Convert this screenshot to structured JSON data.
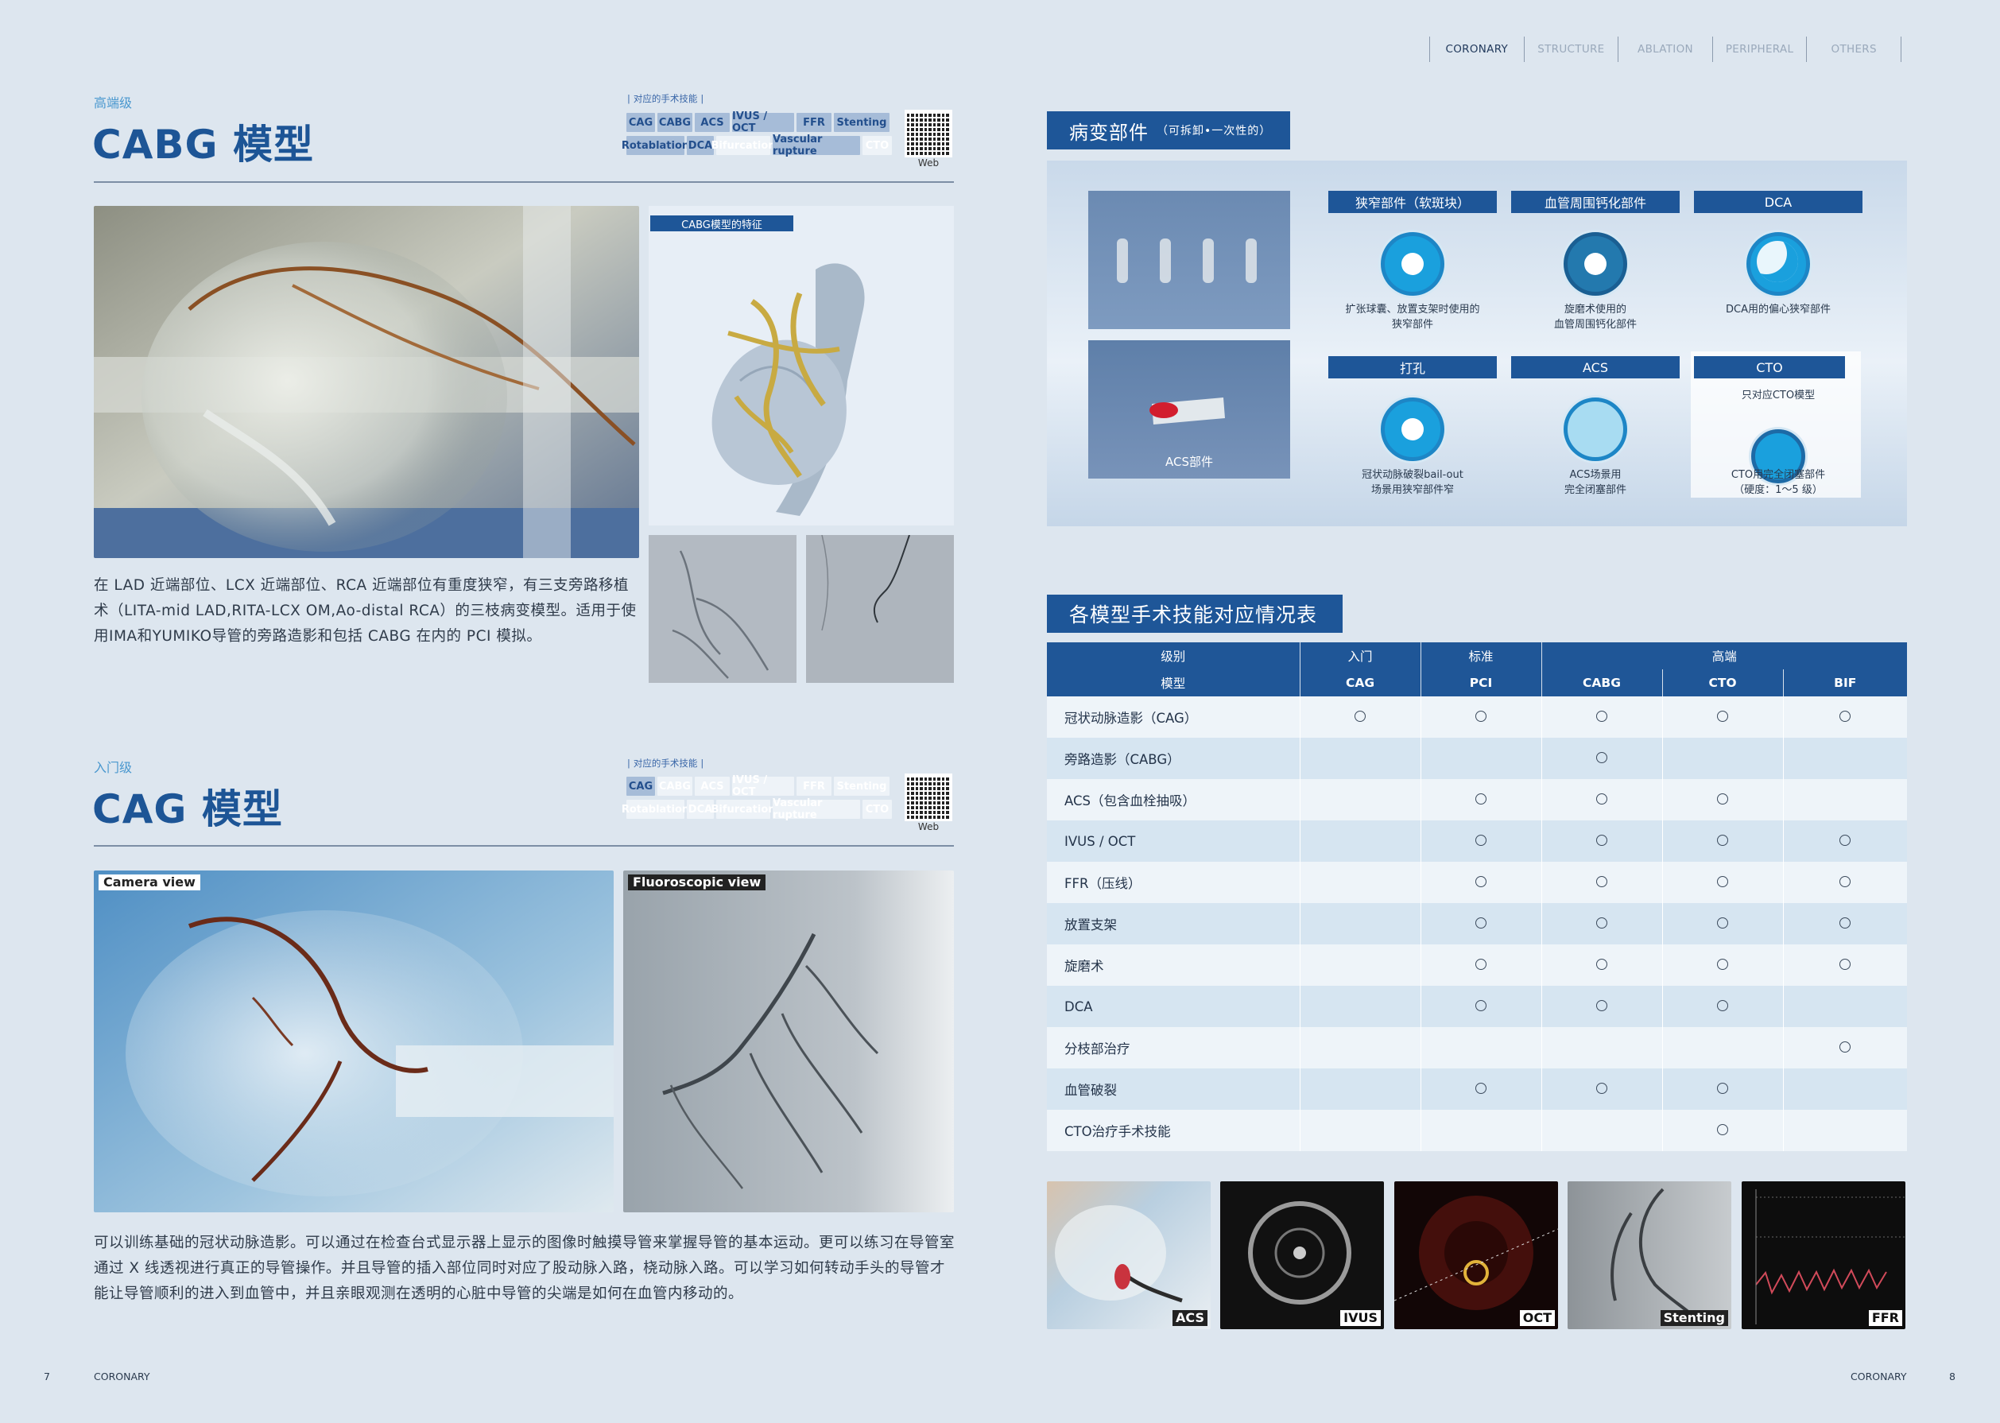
{
  "nav": {
    "tabs": [
      "CORONARY",
      "STRUCTURE",
      "ABLATION",
      "PERIPHERAL",
      "OTHERS"
    ]
  },
  "cabg": {
    "level": "高端级",
    "title": "CABG 模型",
    "skills_label": "对应的手术技能",
    "tags": [
      {
        "label": "CAG",
        "on": true
      },
      {
        "label": "CABG",
        "on": true
      },
      {
        "label": "ACS",
        "on": true
      },
      {
        "label": "IVUS / OCT",
        "on": true
      },
      {
        "label": "FFR",
        "on": true
      },
      {
        "label": "Stenting",
        "on": true
      },
      {
        "label": "Rotablation",
        "on": true
      },
      {
        "label": "DCA",
        "on": true
      },
      {
        "label": "Bifurcation",
        "on": false
      },
      {
        "label": "Vascular rupture",
        "on": true
      },
      {
        "label": "CTO",
        "on": false
      }
    ],
    "qr_label": "Web",
    "feature_label": "CABG模型的特征",
    "description": "在 LAD 近端部位、LCX 近端部位、RCA 近端部位有重度狭窄，有三支旁路移植术（LITA-mid LAD,RITA-LCX OM,Ao-distal RCA）的三枝病变模型。适用于使用IMA和YUMIKO导管的旁路造影和包括 CABG 在内的 PCI 模拟。"
  },
  "cag": {
    "level": "入门级",
    "title": "CAG 模型",
    "skills_label": "对应的手术技能",
    "tags": [
      {
        "label": "CAG",
        "on": true
      },
      {
        "label": "CABG",
        "on": false
      },
      {
        "label": "ACS",
        "on": false
      },
      {
        "label": "IVUS / OCT",
        "on": false
      },
      {
        "label": "FFR",
        "on": false
      },
      {
        "label": "Stenting",
        "on": false
      },
      {
        "label": "Rotablation",
        "on": false
      },
      {
        "label": "DCA",
        "on": false
      },
      {
        "label": "Bifurcation",
        "on": false
      },
      {
        "label": "Vascular rupture",
        "on": false
      },
      {
        "label": "CTO",
        "on": false
      }
    ],
    "qr_label": "Web",
    "camera_label": "Camera view",
    "fluoro_label": "Fluoroscopic view",
    "description": "可以训练基础的冠状动脉造影。可以通过在检查台式显示器上显示的图像时触摸导管来掌握导管的基本运动。更可以练习在导管室通过 X 线透视进行真正的导管操作。并且导管的插入部位同时对应了股动脉入路，桡动脉入路。可以学习如何转动手头的导管才能让导管顺利的进入到血管中，并且亲眼观测在透明的心脏中导管的尖端是如何在血管内移动的。"
  },
  "parts": {
    "heading": "病变部件",
    "heading_note": "（可拆卸•一次性的）",
    "acs_photo_label": "ACS部件",
    "items": [
      {
        "title": "狭窄部件（软斑块）",
        "caption": "扩张球囊、放置支架时使用的\n狭窄部件"
      },
      {
        "title": "血管周围钙化部件",
        "caption": "旋磨术使用的\n血管周围钙化部件"
      },
      {
        "title": "DCA",
        "caption": "DCA用的偏心狭窄部件"
      },
      {
        "title": "打孔",
        "caption": "冠状动脉破裂bail-out\n场景用狭窄部件窄"
      },
      {
        "title": "ACS",
        "caption": "ACS场景用\n完全闭塞部件"
      },
      {
        "title": "CTO",
        "note": "只对应CTO模型",
        "caption": "CTO用完全闭塞部件\n（硬度：1～5 级）"
      }
    ]
  },
  "table": {
    "heading": "各模型手术技能对应情况表",
    "level_label": "级别",
    "model_label": "模型",
    "levels": [
      "入门",
      "标准",
      "高端"
    ],
    "models": [
      "CAG",
      "PCI",
      "CABG",
      "CTO",
      "BIF"
    ],
    "rows": [
      {
        "name": "冠状动脉造影（CAG）",
        "marks": [
          true,
          true,
          true,
          true,
          true
        ]
      },
      {
        "name": "旁路造影（CABG）",
        "marks": [
          false,
          false,
          true,
          false,
          false
        ]
      },
      {
        "name": "ACS（包含血栓抽吸）",
        "marks": [
          false,
          true,
          true,
          true,
          false
        ]
      },
      {
        "name": "IVUS / OCT",
        "marks": [
          false,
          true,
          true,
          true,
          true
        ]
      },
      {
        "name": "FFR（压线）",
        "marks": [
          false,
          true,
          true,
          true,
          true
        ]
      },
      {
        "name": "放置支架",
        "marks": [
          false,
          true,
          true,
          true,
          true
        ]
      },
      {
        "name": "旋磨术",
        "marks": [
          false,
          true,
          true,
          true,
          true
        ]
      },
      {
        "name": "DCA",
        "marks": [
          false,
          true,
          true,
          true,
          false
        ]
      },
      {
        "name": "分枝部治疗",
        "marks": [
          false,
          false,
          false,
          false,
          true
        ]
      },
      {
        "name": "血管破裂",
        "marks": [
          false,
          true,
          true,
          true,
          false
        ]
      },
      {
        "name": "CTO治疗手术技能",
        "marks": [
          false,
          false,
          false,
          true,
          false
        ]
      }
    ]
  },
  "thumbs": [
    "ACS",
    "IVUS",
    "OCT",
    "Stenting",
    "FFR"
  ],
  "footer": {
    "left_page": "7",
    "left_section": "CORONARY",
    "right_section": "CORONARY",
    "right_page": "8"
  },
  "colors": {
    "accent": "#1e5698",
    "page_bg": "#dde6ef"
  }
}
